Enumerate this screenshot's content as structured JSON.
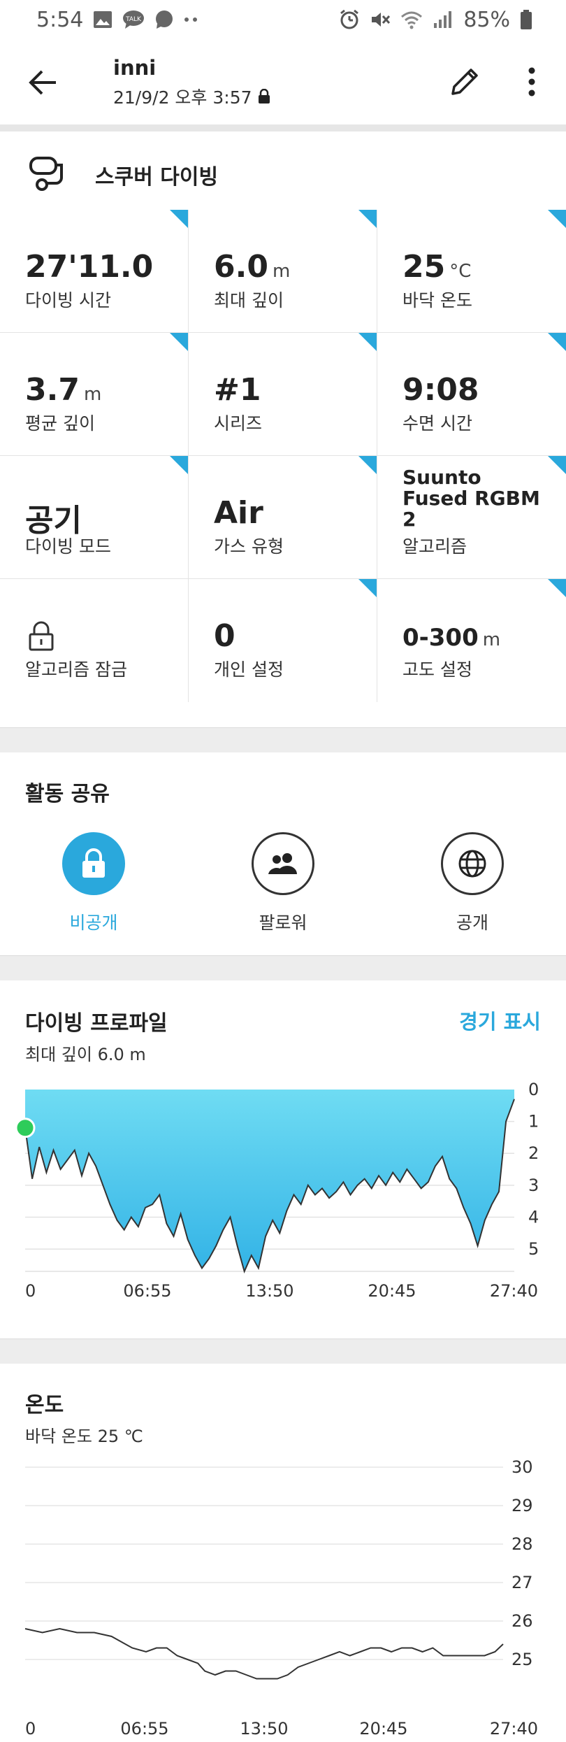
{
  "status_bar": {
    "time": "5:54",
    "battery": "85%"
  },
  "header": {
    "user_name": "inni",
    "date": "21/9/2 오후 3:57"
  },
  "activity": {
    "title": "스쿠버 다이빙"
  },
  "stats": [
    {
      "value": "27'11.0",
      "unit": "",
      "label": "다이빙 시간"
    },
    {
      "value": "6.0",
      "unit": "m",
      "label": "최대 깊이"
    },
    {
      "value": "25",
      "unit": "°C",
      "label": "바닥 온도"
    },
    {
      "value": "3.7",
      "unit": "m",
      "label": "평균 깊이"
    },
    {
      "value": "#1",
      "unit": "",
      "label": "시리즈"
    },
    {
      "value": "9:08",
      "unit": "",
      "label": "수면 시간"
    },
    {
      "value": "공기",
      "unit": "",
      "label": "다이빙 모드"
    },
    {
      "value": "Air",
      "unit": "",
      "label": "가스 유형"
    },
    {
      "value": "Suunto Fused RGBM 2",
      "unit": "",
      "label": "알고리즘"
    },
    {
      "value": "",
      "unit": "",
      "label": "알고리즘 잠금"
    },
    {
      "value": "0",
      "unit": "",
      "label": "개인 설정"
    },
    {
      "value": "0-300",
      "unit": "m",
      "label": "고도 설정"
    }
  ],
  "sharing": {
    "title": "활동 공유",
    "options": [
      {
        "label": "비공개",
        "icon": "lock-icon",
        "active": true
      },
      {
        "label": "팔로워",
        "icon": "followers-icon",
        "active": false
      },
      {
        "label": "공개",
        "icon": "globe-icon",
        "active": false
      }
    ]
  },
  "dive_profile": {
    "title": "다이빙 프로파일",
    "link": "경기 표시",
    "subtitle": "최대 깊이 6.0 m"
  },
  "temperature": {
    "title": "온도",
    "subtitle": "바닥 온도 25 ℃"
  },
  "colors": {
    "accent": "#2aa8dc",
    "profile_fill_top": "#6fdcf3",
    "profile_fill_bottom": "#33b3e6",
    "marker": "#2ecc5a"
  },
  "chart_data": [
    {
      "type": "area",
      "name": "dive-profile",
      "x_ticks": [
        "0",
        "06:55",
        "13:50",
        "20:45",
        "27:40"
      ],
      "y_ticks": [
        "0",
        "1",
        "2",
        "3",
        "4",
        "5"
      ],
      "y_inverted": true,
      "ylim": [
        0,
        5.7
      ],
      "xlim": [
        0,
        27.67
      ],
      "x": [
        0,
        0.4,
        0.8,
        1.2,
        1.6,
        2.0,
        2.4,
        2.8,
        3.2,
        3.6,
        4.0,
        4.4,
        4.8,
        5.2,
        5.6,
        6.0,
        6.4,
        6.8,
        7.2,
        7.6,
        8.0,
        8.4,
        8.8,
        9.2,
        9.6,
        10.0,
        10.4,
        10.8,
        11.2,
        11.6,
        12.0,
        12.4,
        12.8,
        13.2,
        13.6,
        14.0,
        14.4,
        14.8,
        15.2,
        15.6,
        16.0,
        16.4,
        16.8,
        17.2,
        17.6,
        18.0,
        18.4,
        18.8,
        19.2,
        19.6,
        20.0,
        20.4,
        20.8,
        21.2,
        21.6,
        22.0,
        22.4,
        22.8,
        23.2,
        23.6,
        24.0,
        24.4,
        24.8,
        25.2,
        25.6,
        26.0,
        26.4,
        26.8,
        27.2,
        27.67
      ],
      "values": [
        1.2,
        2.8,
        1.8,
        2.6,
        1.9,
        2.5,
        2.2,
        1.9,
        2.7,
        2.0,
        2.4,
        3.0,
        3.6,
        4.1,
        4.4,
        4.0,
        4.3,
        3.7,
        3.6,
        3.3,
        4.2,
        4.6,
        3.9,
        4.7,
        5.2,
        5.6,
        5.3,
        4.9,
        4.4,
        4.0,
        4.9,
        5.7,
        5.2,
        5.6,
        4.6,
        4.1,
        4.5,
        3.8,
        3.3,
        3.6,
        3.0,
        3.3,
        3.1,
        3.4,
        3.2,
        2.9,
        3.3,
        3.0,
        2.8,
        3.1,
        2.7,
        3.0,
        2.6,
        2.9,
        2.5,
        2.8,
        3.1,
        2.9,
        2.4,
        2.1,
        2.8,
        3.1,
        3.7,
        4.2,
        4.9,
        4.1,
        3.6,
        3.2,
        1.0,
        0.3
      ],
      "current_marker": {
        "x": 0,
        "y": 1.2
      }
    },
    {
      "type": "line",
      "name": "temperature",
      "x_ticks": [
        "0",
        "06:55",
        "13:50",
        "20:45",
        "27:40"
      ],
      "y_ticks": [
        "30",
        "29",
        "28",
        "27",
        "26",
        "25"
      ],
      "ylim": [
        24.5,
        30
      ],
      "xlim": [
        0,
        27.67
      ],
      "x": [
        0,
        1.0,
        2.0,
        3.0,
        4.0,
        5.0,
        5.8,
        6.2,
        7.0,
        7.6,
        8.2,
        8.8,
        9.4,
        10.0,
        10.4,
        11.0,
        11.6,
        12.2,
        12.8,
        13.4,
        14.0,
        14.6,
        15.2,
        15.8,
        16.4,
        17.0,
        17.6,
        18.2,
        18.8,
        19.4,
        20.0,
        20.6,
        21.2,
        21.8,
        22.4,
        23.0,
        23.6,
        24.2,
        24.8,
        25.4,
        26.0,
        26.6,
        27.2,
        27.67
      ],
      "values": [
        25.8,
        25.7,
        25.8,
        25.7,
        25.7,
        25.6,
        25.4,
        25.3,
        25.2,
        25.3,
        25.3,
        25.1,
        25.0,
        24.9,
        24.7,
        24.6,
        24.7,
        24.7,
        24.6,
        24.5,
        24.5,
        24.5,
        24.6,
        24.8,
        24.9,
        25.0,
        25.1,
        25.2,
        25.1,
        25.2,
        25.3,
        25.3,
        25.2,
        25.3,
        25.3,
        25.2,
        25.3,
        25.1,
        25.1,
        25.1,
        25.1,
        25.1,
        25.2,
        25.4
      ]
    }
  ]
}
